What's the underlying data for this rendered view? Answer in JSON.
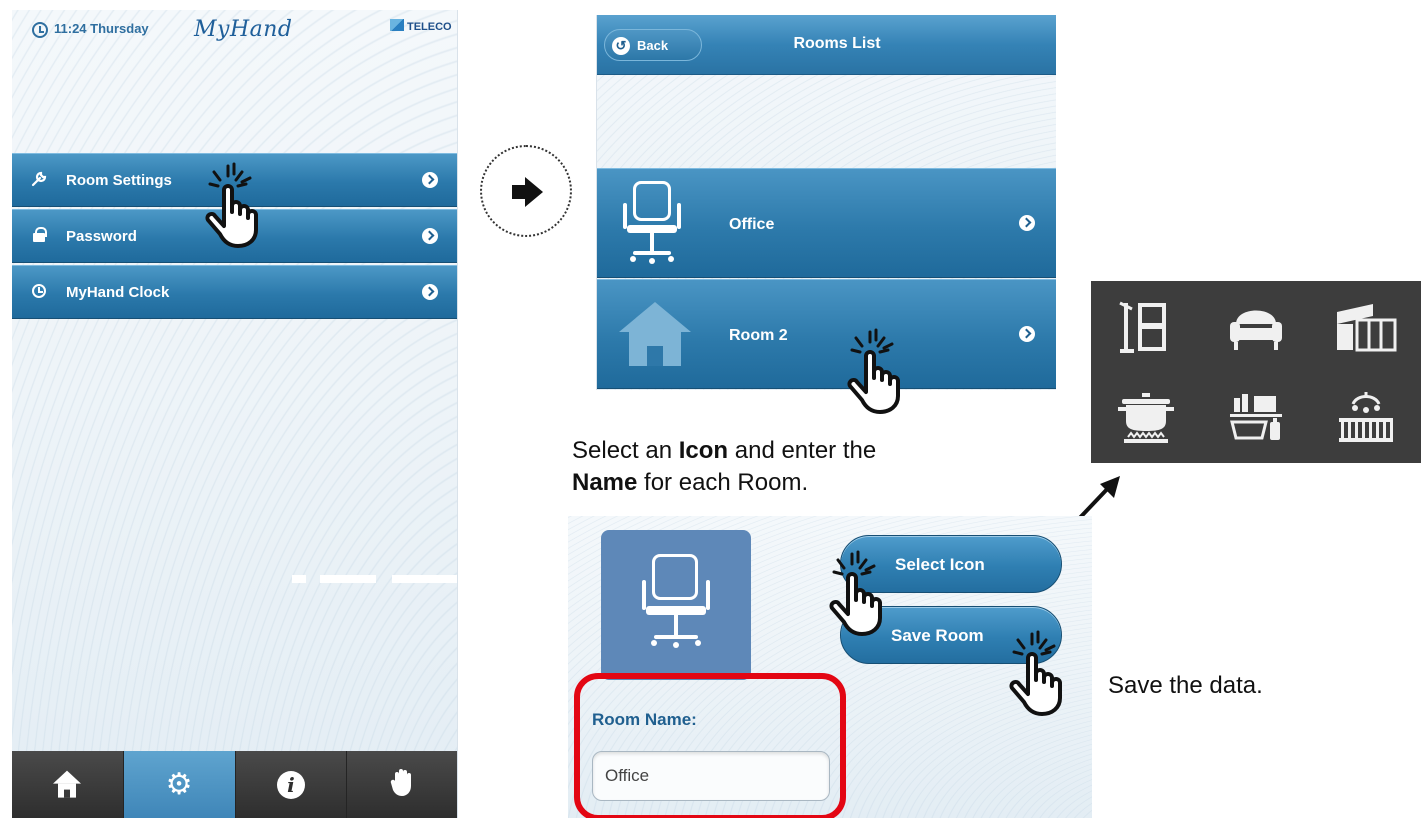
{
  "phone1": {
    "status": {
      "time": "11:24 Thursday",
      "brand": "MyHand",
      "vendor": "TELECO"
    },
    "menu": [
      {
        "label": "Room Settings",
        "icon": "wrench-icon"
      },
      {
        "label": "Password",
        "icon": "lock-icon"
      },
      {
        "label": "MyHand Clock",
        "icon": "clock-icon"
      }
    ],
    "tabs": [
      {
        "name": "home",
        "icon": "home-icon",
        "active": false
      },
      {
        "name": "settings",
        "icon": "gear-icon",
        "active": true
      },
      {
        "name": "info",
        "icon": "info-icon",
        "active": false
      },
      {
        "name": "hand",
        "icon": "hand-icon",
        "active": false
      }
    ]
  },
  "phone2": {
    "back_label": "Back",
    "title": "Rooms List",
    "rooms": [
      {
        "label": "Office",
        "icon": "office-chair-icon"
      },
      {
        "label": "Room 2",
        "icon": "house-icon"
      }
    ]
  },
  "icon_panel": {
    "icons": [
      "kitchen-icon",
      "armchair-icon",
      "greenhouse-icon",
      "cooking-pot-icon",
      "bathroom-icon",
      "crib-icon"
    ]
  },
  "caption": {
    "p1": "Select an ",
    "icon_word": "Icon",
    "p2": " and enter the",
    "name_word": "Name",
    "p3": " for each Room."
  },
  "phone3": {
    "select_icon_label": "Select Icon",
    "save_room_label": "Save Room",
    "room_name_label": "Room Name:",
    "room_name_value": "Office"
  },
  "save_caption": "Save the data.",
  "colors": {
    "accent_blue": "#2b79ab",
    "highlight_red": "#e30613",
    "icon_box": "#5e88b8"
  }
}
